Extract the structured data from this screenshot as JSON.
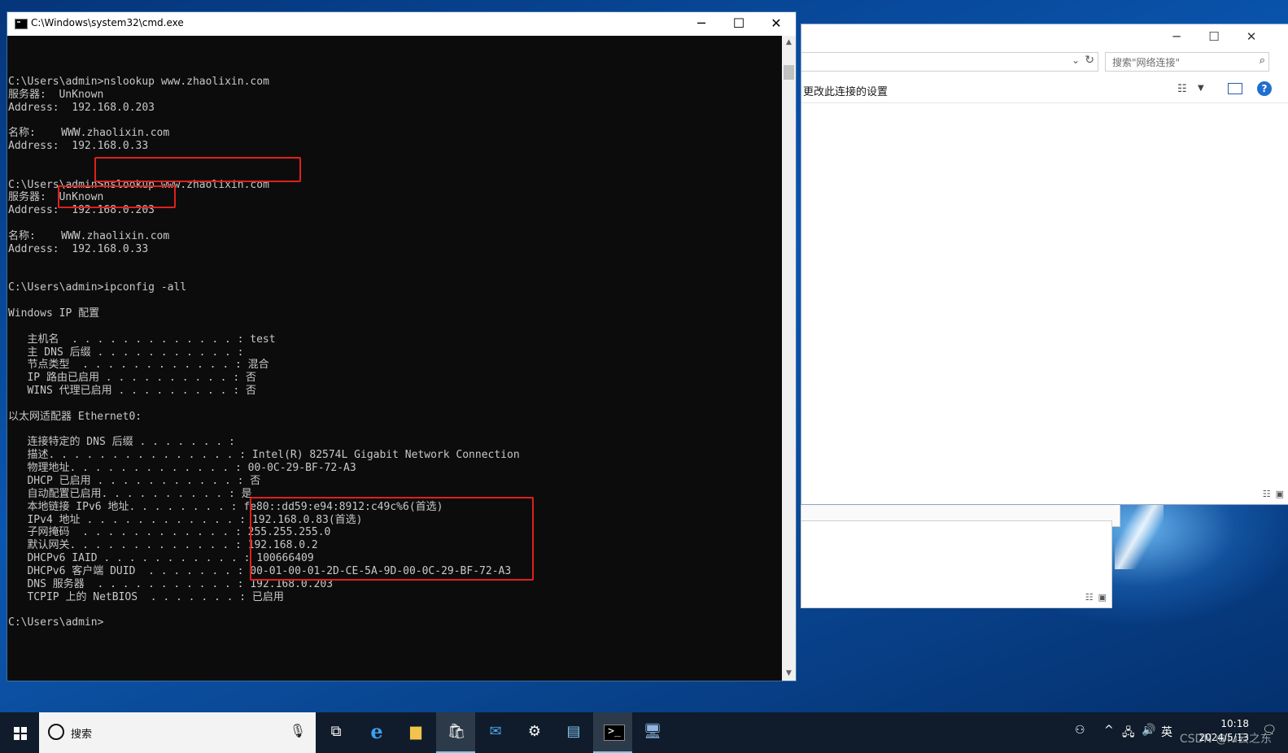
{
  "cmd": {
    "title": "C:\\Windows\\system32\\cmd.exe",
    "minimize": "─",
    "maximize": "☐",
    "close": "✕",
    "lines": [
      "",
      "C:\\Users\\admin>nslookup www.zhaolixin.com",
      "服务器:  UnKnown",
      "Address:  192.168.0.203",
      "",
      "名称:    WWW.zhaolixin.com",
      "Address:  192.168.0.33",
      "",
      "",
      "C:\\Users\\admin>nslookup www.zhaolixin.com",
      "服务器:  UnKnown",
      "Address:  192.168.0.203",
      "",
      "名称:    WWW.zhaolixin.com",
      "Address:  192.168.0.33",
      "",
      "",
      "C:\\Users\\admin>ipconfig -all",
      "",
      "Windows IP 配置",
      "",
      "   主机名  . . . . . . . . . . . . . : test",
      "   主 DNS 后缀 . . . . . . . . . . . :",
      "   节点类型  . . . . . . . . . . . . : 混合",
      "   IP 路由已启用 . . . . . . . . . . : 否",
      "   WINS 代理已启用 . . . . . . . . . : 否",
      "",
      "以太网适配器 Ethernet0:",
      "",
      "   连接特定的 DNS 后缀 . . . . . . . :",
      "   描述. . . . . . . . . . . . . . . : Intel(R) 82574L Gigabit Network Connection",
      "   物理地址. . . . . . . . . . . . . : 00-0C-29-BF-72-A3",
      "   DHCP 已启用 . . . . . . . . . . . : 否",
      "   自动配置已启用. . . . . . . . . . : 是",
      "   本地链接 IPv6 地址. . . . . . . . : fe80::dd59:e94:8912:c49c%6(首选)",
      "   IPv4 地址 . . . . . . . . . . . . : 192.168.0.83(首选)",
      "   子网掩码  . . . . . . . . . . . . : 255.255.255.0",
      "   默认网关. . . . . . . . . . . . . : 192.168.0.2",
      "   DHCPv6 IAID . . . . . . . . . . . : 100666409",
      "   DHCPv6 客户端 DUID  . . . . . . . : 00-01-00-01-2D-CE-5A-9D-00-0C-29-BF-72-A3",
      "   DNS 服务器  . . . . . . . . . . . : 192.168.0.203",
      "   TCPIP 上的 NetBIOS  . . . . . . . : 已启用",
      "",
      "C:\\Users\\admin>"
    ]
  },
  "explorer": {
    "search_placeholder": "搜索\"网络连接\"",
    "toolbar_command": "更改此连接的设置",
    "help": "?"
  },
  "taskbar": {
    "search_text": "搜索",
    "clock_time": "10:18",
    "clock_date": "2024/5/13",
    "ime": "英",
    "watermark": "CSDN @lu云之东"
  },
  "highlight_color": "#e0201b"
}
